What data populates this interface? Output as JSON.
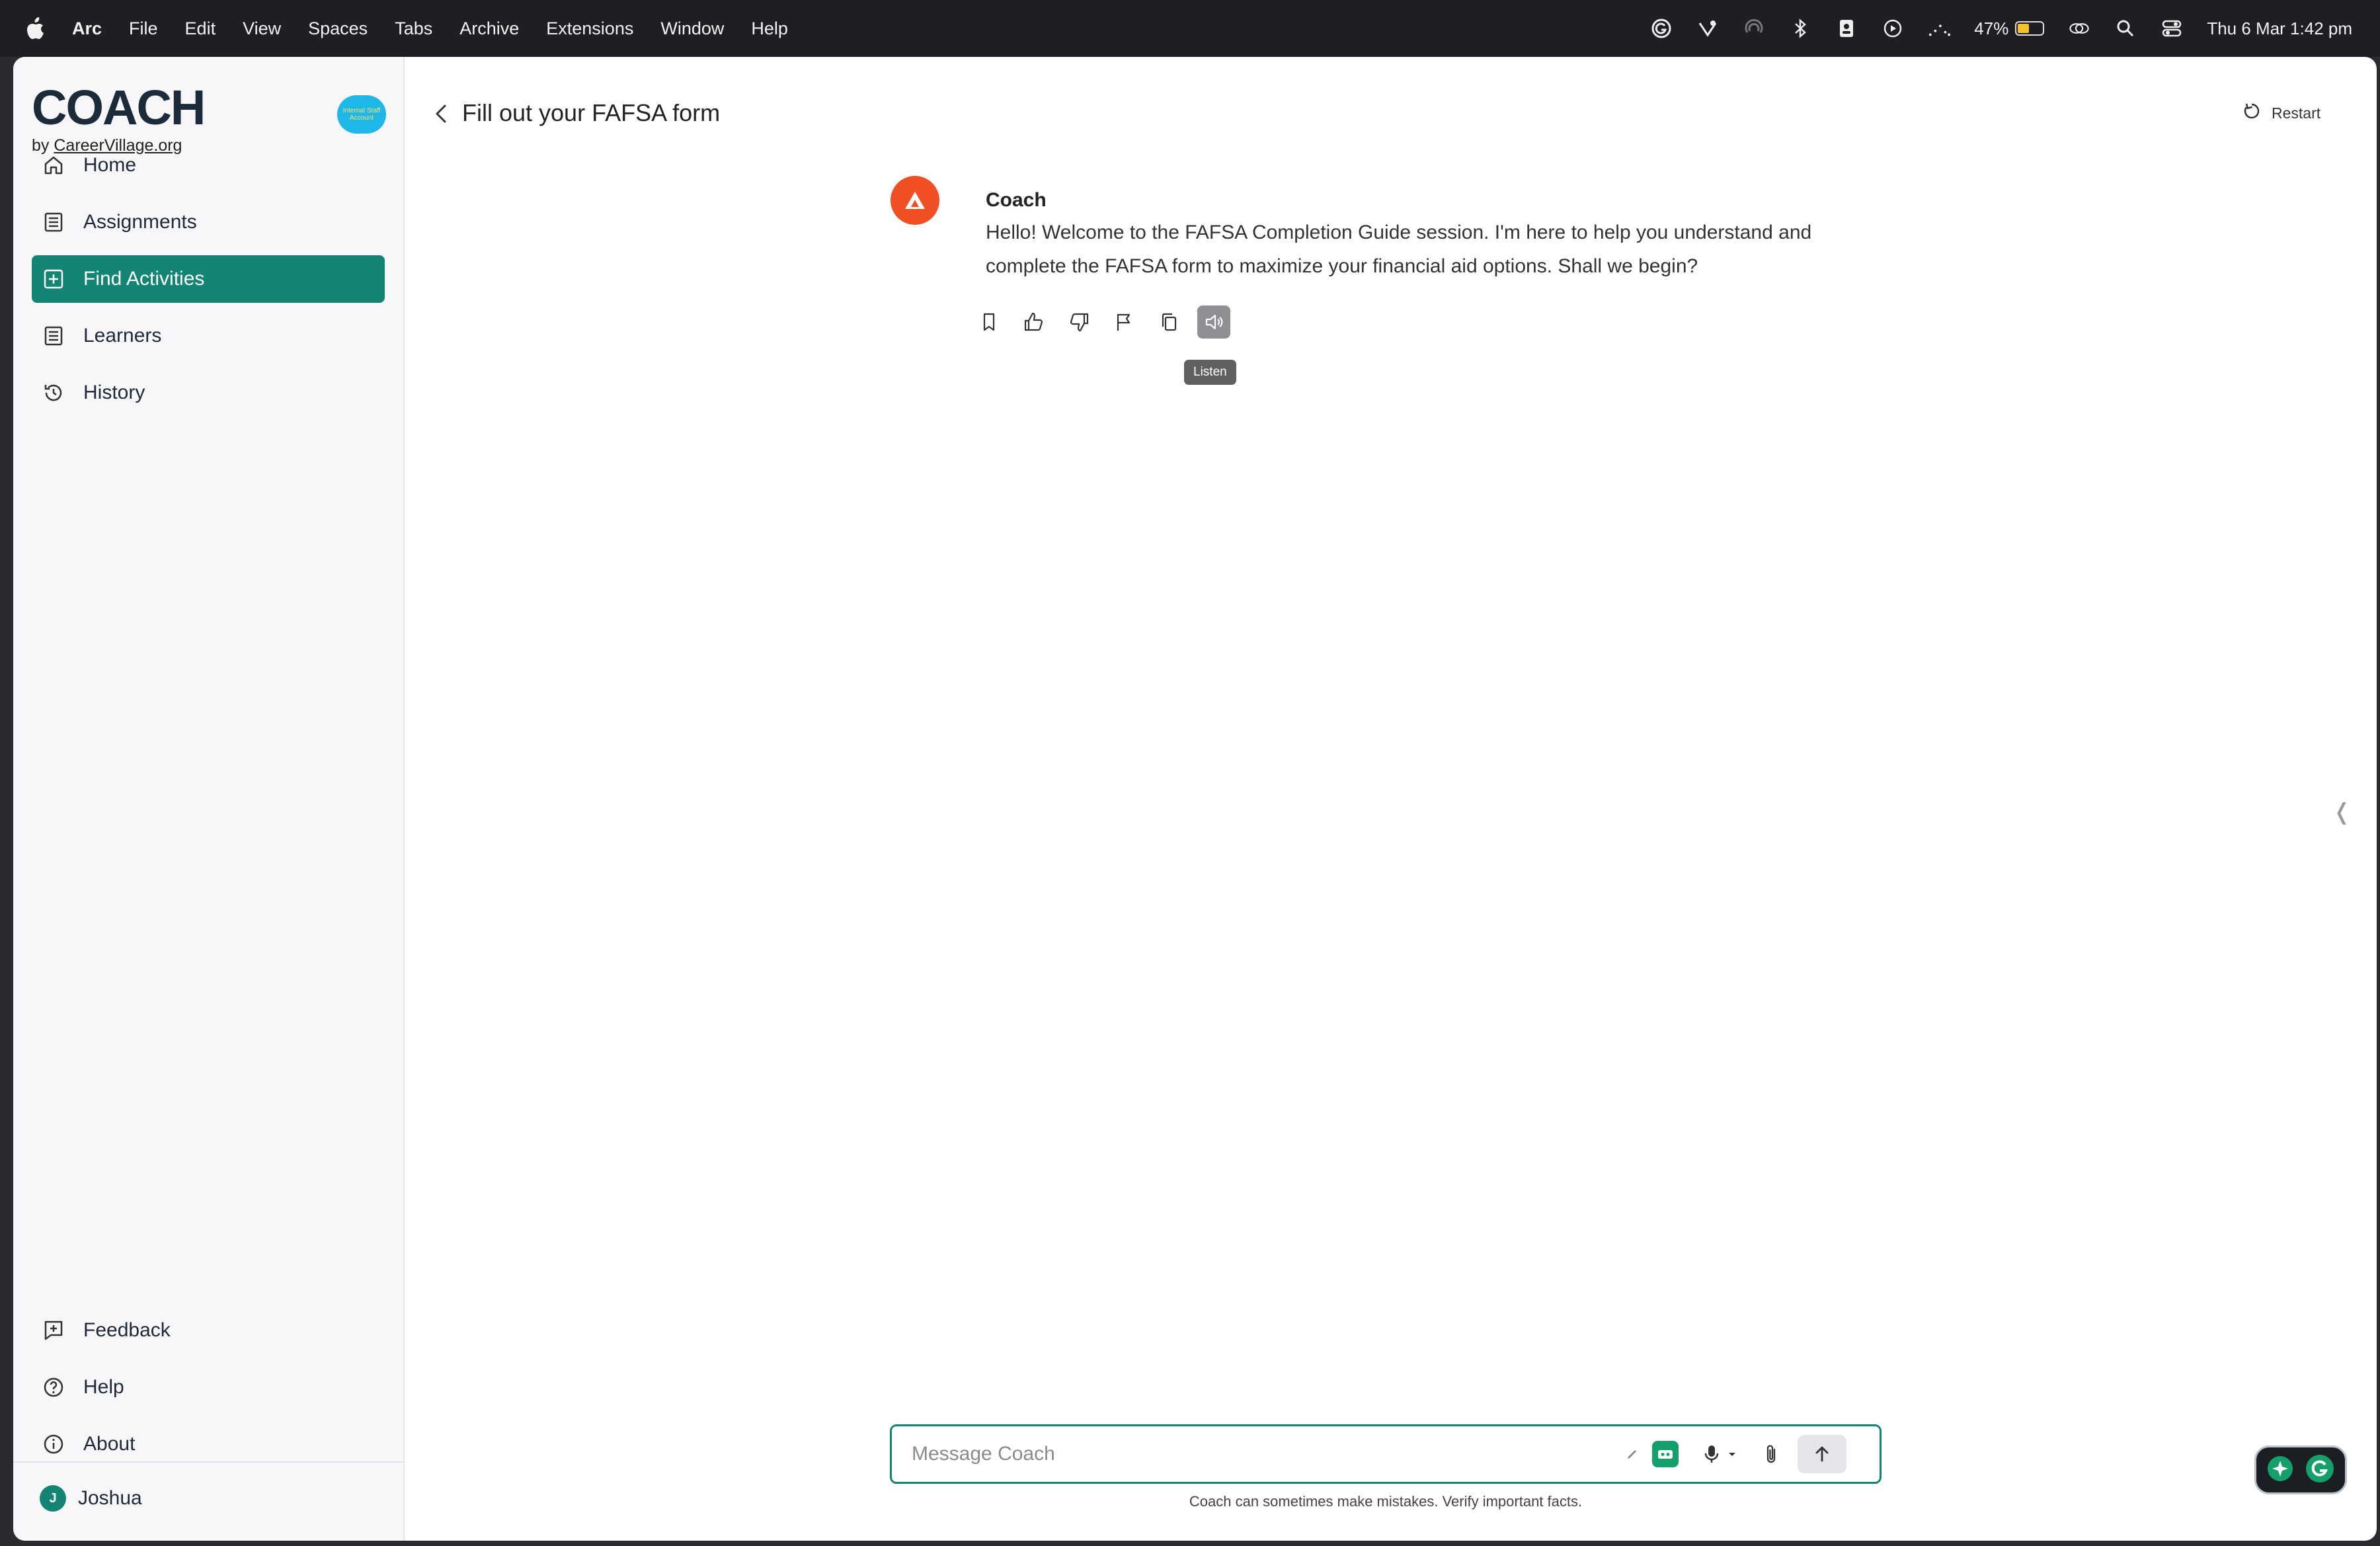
{
  "menubar": {
    "app": "Arc",
    "menus": [
      "File",
      "Edit",
      "View",
      "Spaces",
      "Tabs",
      "Archive",
      "Extensions",
      "Window",
      "Help"
    ],
    "battery_percent": "47%",
    "battery_level": 0.47,
    "datetime": "Thu 6 Mar  1:42 pm"
  },
  "sidebar": {
    "logo": "COACH",
    "logo_sub_prefix": "by ",
    "logo_sub_link": "CareerVillage.org",
    "badge": "Internal Staff Account",
    "nav": [
      {
        "label": "Home",
        "icon": "home-icon"
      },
      {
        "label": "Assignments",
        "icon": "list-icon"
      },
      {
        "label": "Find Activities",
        "icon": "plus-square-icon",
        "active": true
      },
      {
        "label": "Learners",
        "icon": "list-icon"
      },
      {
        "label": "History",
        "icon": "history-icon"
      }
    ],
    "bottom_nav": [
      {
        "label": "Feedback",
        "icon": "feedback-icon"
      },
      {
        "label": "Help",
        "icon": "help-icon"
      },
      {
        "label": "About",
        "icon": "info-icon"
      }
    ],
    "user": {
      "initial": "J",
      "name": "Joshua"
    }
  },
  "header": {
    "title": "Fill out your FAFSA form",
    "restart_label": "Restart"
  },
  "conversation": {
    "sender": "Coach",
    "message": "Hello! Welcome to the FAFSA Completion Guide session. I'm here to help you understand and complete the FAFSA form to maximize your financial aid options. Shall we begin?",
    "tooltip": "Listen"
  },
  "composer": {
    "placeholder": "Message Coach",
    "disclaimer": "Coach can sometimes make mistakes. Verify important facts."
  },
  "colors": {
    "accent": "#148474",
    "coach_avatar": "#f04e23"
  }
}
